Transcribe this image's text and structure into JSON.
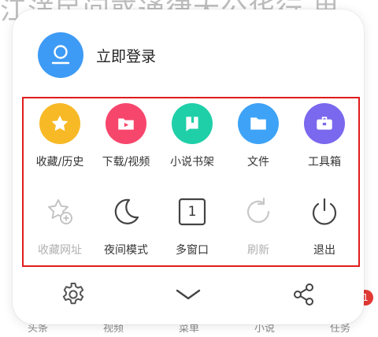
{
  "background": {
    "headline": "江洋民间惑通律大公华行 里",
    "tabs": [
      "头条",
      "视频",
      "菜单",
      "小说",
      "任务"
    ],
    "badge": "1"
  },
  "login": {
    "label": "立即登录"
  },
  "menu": {
    "row1": [
      {
        "label": "收藏/历史",
        "icon": "star-icon",
        "color": "#f7b926"
      },
      {
        "label": "下载/视频",
        "icon": "download-video-icon",
        "color": "#f7466c"
      },
      {
        "label": "小说书架",
        "icon": "book-icon",
        "color": "#1fcfa8"
      },
      {
        "label": "文件",
        "icon": "folder-icon",
        "color": "#3ea3f7"
      },
      {
        "label": "工具箱",
        "icon": "toolbox-icon",
        "color": "#7a68ee"
      }
    ],
    "row2": [
      {
        "label": "收藏网址",
        "icon": "add-bookmark-icon",
        "enabled": false
      },
      {
        "label": "夜间模式",
        "icon": "moon-icon",
        "enabled": true
      },
      {
        "label": "多窗口",
        "icon": "window-count-icon",
        "enabled": true,
        "count": "1"
      },
      {
        "label": "刷新",
        "icon": "refresh-icon",
        "enabled": false
      },
      {
        "label": "退出",
        "icon": "power-icon",
        "enabled": true
      }
    ]
  },
  "bottom": {
    "settings_icon": "gear-icon",
    "collapse_icon": "chevron-down-icon",
    "share_icon": "share-icon"
  },
  "colors": {
    "highlight_border": "#e01c1c",
    "avatar": "#3e9bf5"
  }
}
